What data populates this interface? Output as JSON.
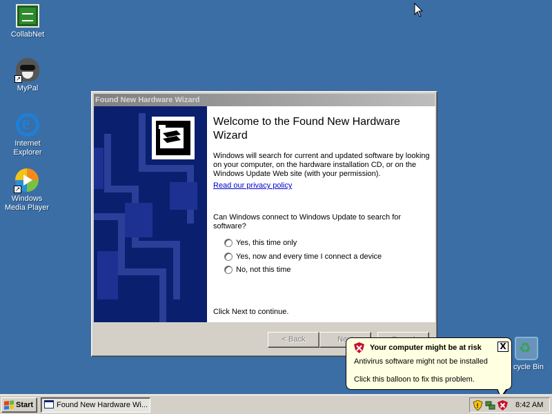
{
  "desktop": {
    "icons": [
      {
        "label": "CollabNet",
        "icon": "collabnet-icon"
      },
      {
        "label": "MyPal",
        "icon": "raccoon-icon"
      },
      {
        "label": "Internet Explorer",
        "icon": "internet-explorer-icon"
      },
      {
        "label": "Windows Media Player",
        "icon": "media-player-icon"
      },
      {
        "label": "cycle Bin",
        "icon": "recycle-bin-icon"
      }
    ]
  },
  "wizard": {
    "window_title": "Found New Hardware Wizard",
    "heading": "Welcome to the Found New Hardware Wizard",
    "description": "Windows will search for current and updated software by looking on your computer, on the hardware installation CD, or on the Windows Update Web site (with your permission).",
    "privacy_link": "Read our privacy policy",
    "question": "Can Windows connect to Windows Update to search for software?",
    "options": [
      {
        "label": "Yes, this time only",
        "selected": false
      },
      {
        "label": "Yes, now and every time I connect a device",
        "selected": false
      },
      {
        "label": "No, not this time",
        "selected": false
      }
    ],
    "footer_text": "Click Next to continue.",
    "buttons": {
      "back": "< Back",
      "next": "Next",
      "cancel": "Cancel"
    }
  },
  "balloon": {
    "title": "Your computer might be at risk",
    "line1": "Antivirus software might not be installed",
    "line2": "Click this balloon to fix this problem.",
    "close": "X"
  },
  "taskbar": {
    "start_label": "Start",
    "task_label": "Found New Hardware Wi...",
    "clock": "8:42 AM"
  },
  "colors": {
    "desktop": "#3a6ea5",
    "wizard_sidebar": "#0a1f6e",
    "balloon": "#ffffe1",
    "shield_red": "#c8102e"
  }
}
